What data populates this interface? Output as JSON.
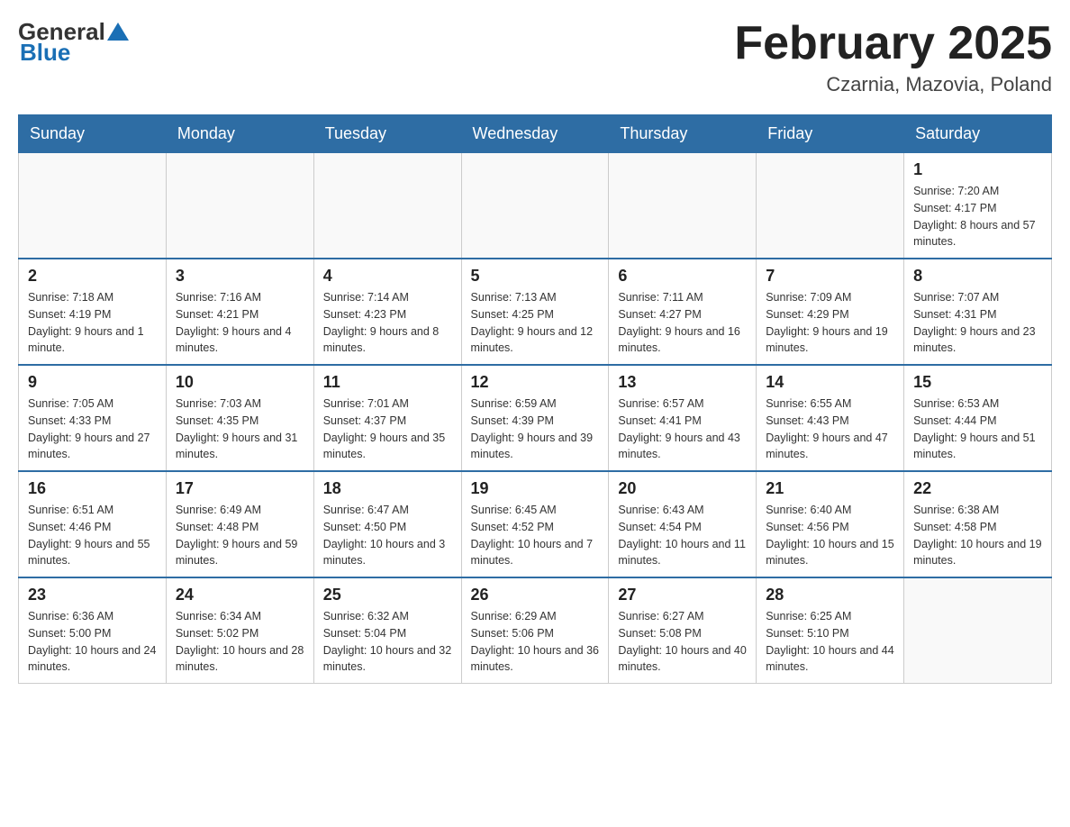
{
  "header": {
    "logo_general": "General",
    "logo_blue": "Blue",
    "title": "February 2025",
    "subtitle": "Czarnia, Mazovia, Poland"
  },
  "weekdays": [
    "Sunday",
    "Monday",
    "Tuesday",
    "Wednesday",
    "Thursday",
    "Friday",
    "Saturday"
  ],
  "weeks": [
    [
      {
        "day": "",
        "info": ""
      },
      {
        "day": "",
        "info": ""
      },
      {
        "day": "",
        "info": ""
      },
      {
        "day": "",
        "info": ""
      },
      {
        "day": "",
        "info": ""
      },
      {
        "day": "",
        "info": ""
      },
      {
        "day": "1",
        "info": "Sunrise: 7:20 AM\nSunset: 4:17 PM\nDaylight: 8 hours and 57 minutes."
      }
    ],
    [
      {
        "day": "2",
        "info": "Sunrise: 7:18 AM\nSunset: 4:19 PM\nDaylight: 9 hours and 1 minute."
      },
      {
        "day": "3",
        "info": "Sunrise: 7:16 AM\nSunset: 4:21 PM\nDaylight: 9 hours and 4 minutes."
      },
      {
        "day": "4",
        "info": "Sunrise: 7:14 AM\nSunset: 4:23 PM\nDaylight: 9 hours and 8 minutes."
      },
      {
        "day": "5",
        "info": "Sunrise: 7:13 AM\nSunset: 4:25 PM\nDaylight: 9 hours and 12 minutes."
      },
      {
        "day": "6",
        "info": "Sunrise: 7:11 AM\nSunset: 4:27 PM\nDaylight: 9 hours and 16 minutes."
      },
      {
        "day": "7",
        "info": "Sunrise: 7:09 AM\nSunset: 4:29 PM\nDaylight: 9 hours and 19 minutes."
      },
      {
        "day": "8",
        "info": "Sunrise: 7:07 AM\nSunset: 4:31 PM\nDaylight: 9 hours and 23 minutes."
      }
    ],
    [
      {
        "day": "9",
        "info": "Sunrise: 7:05 AM\nSunset: 4:33 PM\nDaylight: 9 hours and 27 minutes."
      },
      {
        "day": "10",
        "info": "Sunrise: 7:03 AM\nSunset: 4:35 PM\nDaylight: 9 hours and 31 minutes."
      },
      {
        "day": "11",
        "info": "Sunrise: 7:01 AM\nSunset: 4:37 PM\nDaylight: 9 hours and 35 minutes."
      },
      {
        "day": "12",
        "info": "Sunrise: 6:59 AM\nSunset: 4:39 PM\nDaylight: 9 hours and 39 minutes."
      },
      {
        "day": "13",
        "info": "Sunrise: 6:57 AM\nSunset: 4:41 PM\nDaylight: 9 hours and 43 minutes."
      },
      {
        "day": "14",
        "info": "Sunrise: 6:55 AM\nSunset: 4:43 PM\nDaylight: 9 hours and 47 minutes."
      },
      {
        "day": "15",
        "info": "Sunrise: 6:53 AM\nSunset: 4:44 PM\nDaylight: 9 hours and 51 minutes."
      }
    ],
    [
      {
        "day": "16",
        "info": "Sunrise: 6:51 AM\nSunset: 4:46 PM\nDaylight: 9 hours and 55 minutes."
      },
      {
        "day": "17",
        "info": "Sunrise: 6:49 AM\nSunset: 4:48 PM\nDaylight: 9 hours and 59 minutes."
      },
      {
        "day": "18",
        "info": "Sunrise: 6:47 AM\nSunset: 4:50 PM\nDaylight: 10 hours and 3 minutes."
      },
      {
        "day": "19",
        "info": "Sunrise: 6:45 AM\nSunset: 4:52 PM\nDaylight: 10 hours and 7 minutes."
      },
      {
        "day": "20",
        "info": "Sunrise: 6:43 AM\nSunset: 4:54 PM\nDaylight: 10 hours and 11 minutes."
      },
      {
        "day": "21",
        "info": "Sunrise: 6:40 AM\nSunset: 4:56 PM\nDaylight: 10 hours and 15 minutes."
      },
      {
        "day": "22",
        "info": "Sunrise: 6:38 AM\nSunset: 4:58 PM\nDaylight: 10 hours and 19 minutes."
      }
    ],
    [
      {
        "day": "23",
        "info": "Sunrise: 6:36 AM\nSunset: 5:00 PM\nDaylight: 10 hours and 24 minutes."
      },
      {
        "day": "24",
        "info": "Sunrise: 6:34 AM\nSunset: 5:02 PM\nDaylight: 10 hours and 28 minutes."
      },
      {
        "day": "25",
        "info": "Sunrise: 6:32 AM\nSunset: 5:04 PM\nDaylight: 10 hours and 32 minutes."
      },
      {
        "day": "26",
        "info": "Sunrise: 6:29 AM\nSunset: 5:06 PM\nDaylight: 10 hours and 36 minutes."
      },
      {
        "day": "27",
        "info": "Sunrise: 6:27 AM\nSunset: 5:08 PM\nDaylight: 10 hours and 40 minutes."
      },
      {
        "day": "28",
        "info": "Sunrise: 6:25 AM\nSunset: 5:10 PM\nDaylight: 10 hours and 44 minutes."
      },
      {
        "day": "",
        "info": ""
      }
    ]
  ]
}
